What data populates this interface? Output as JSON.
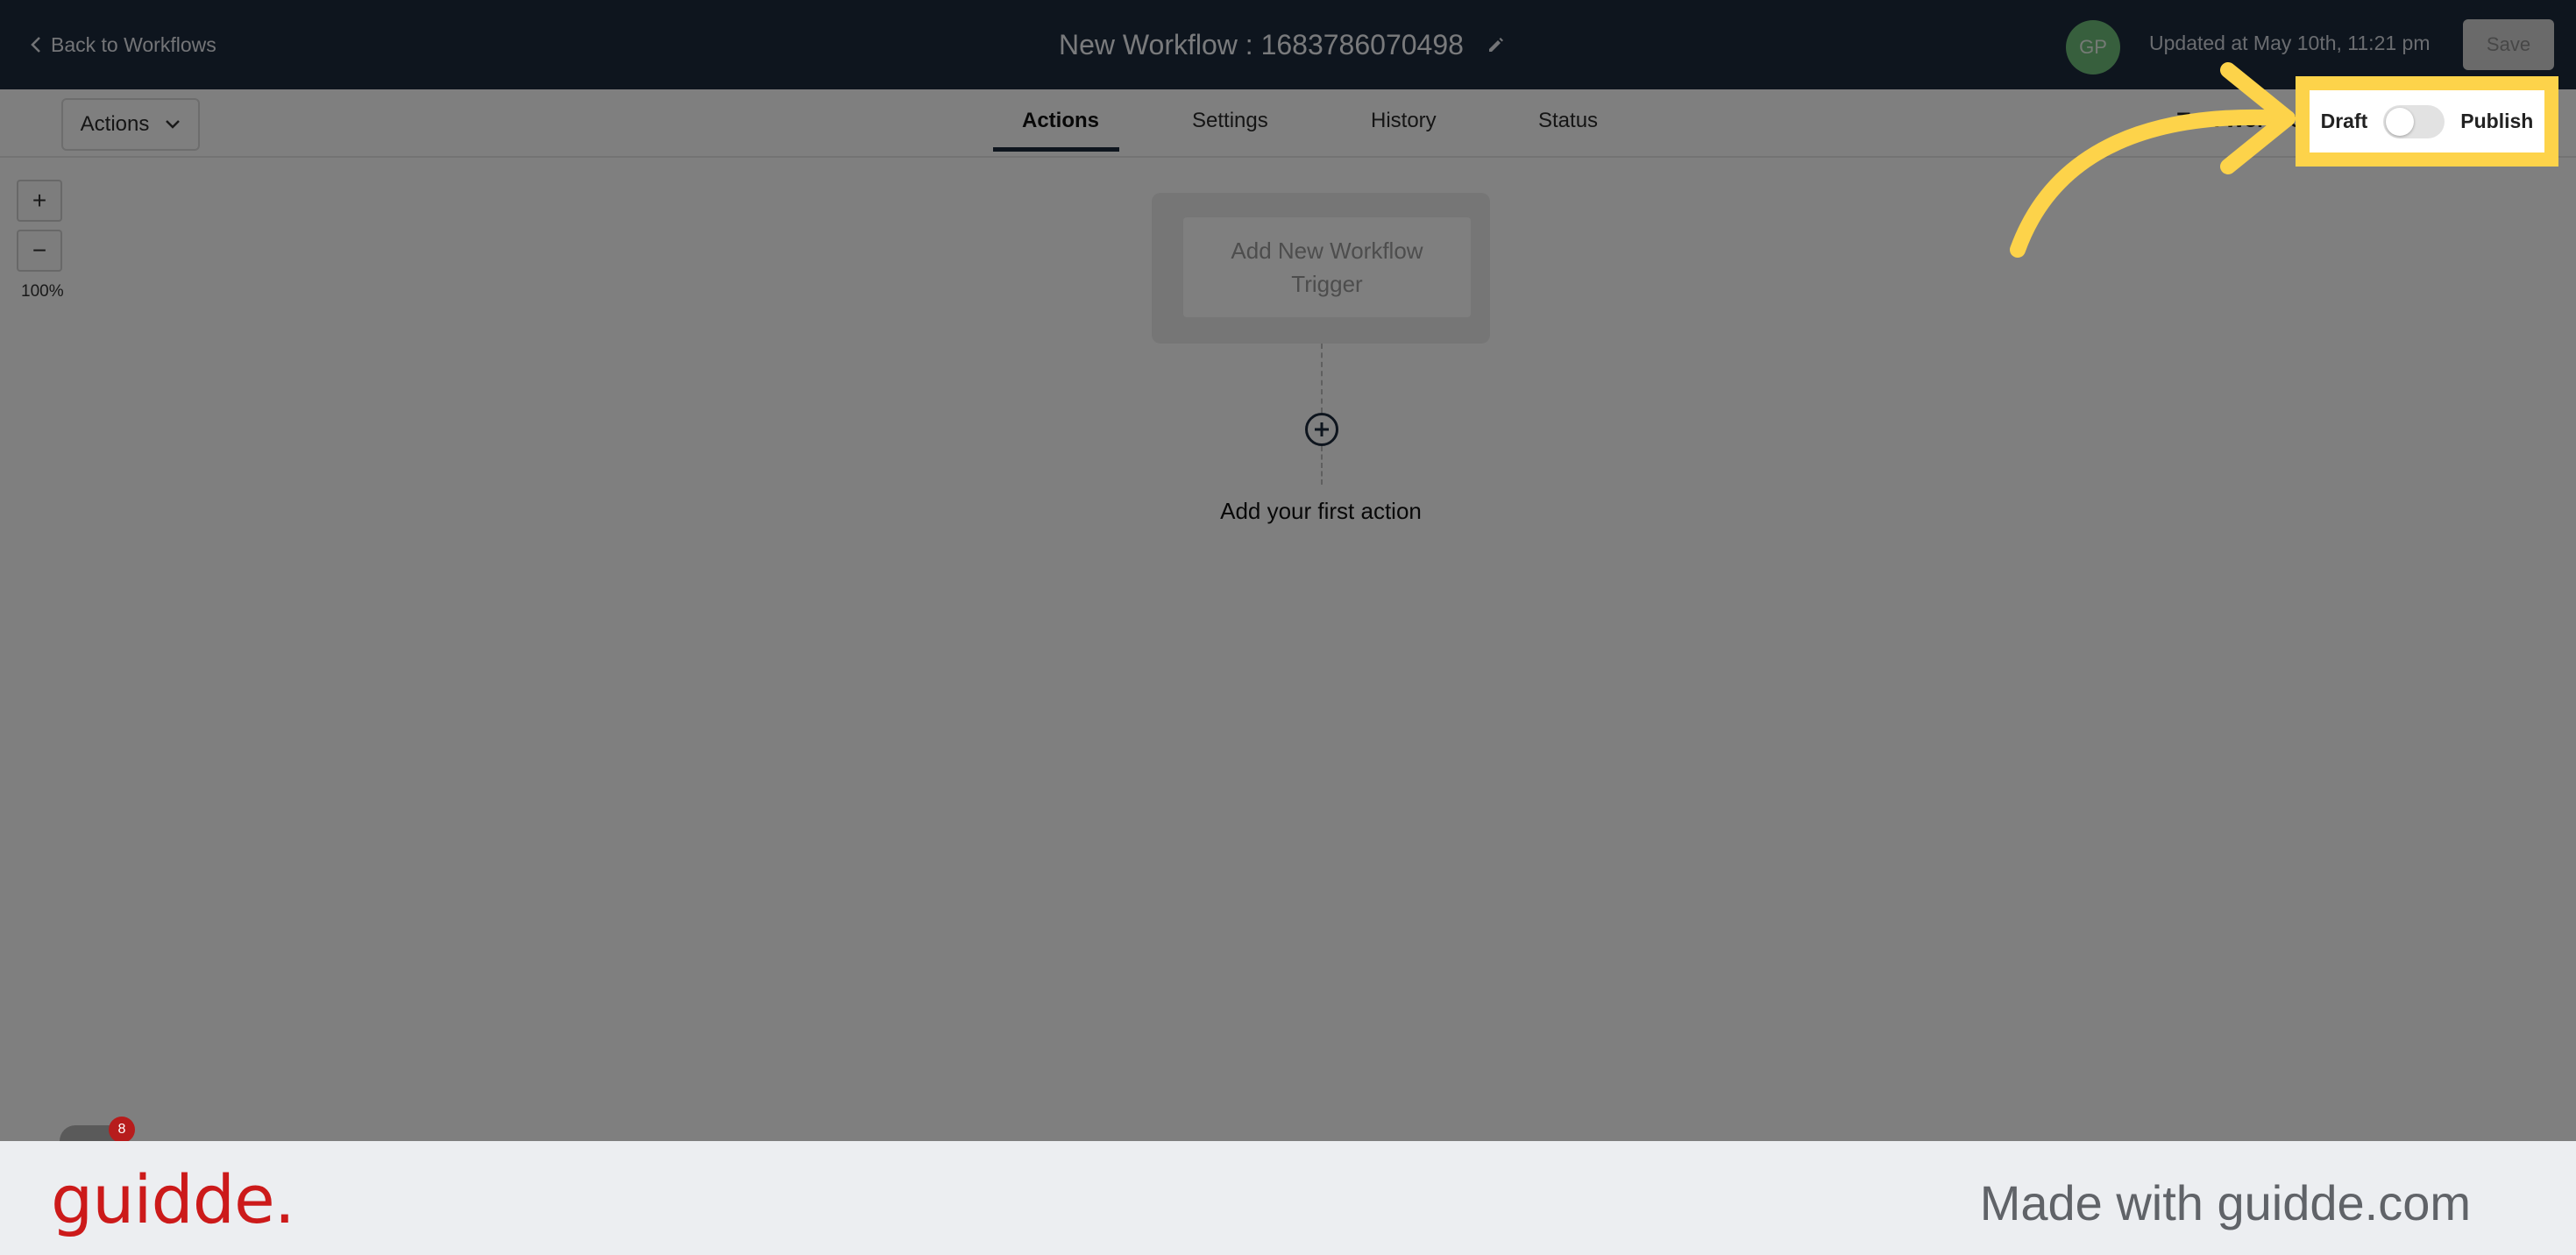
{
  "header": {
    "back_label": "Back to Workflows",
    "workflow_title": "New Workflow : 1683786070498",
    "avatar_initials": "GP",
    "updated_text": "Updated at May 10th, 11:21 pm",
    "save_label": "Save"
  },
  "toolbar": {
    "actions_dropdown_label": "Actions",
    "tabs": [
      {
        "label": "Actions",
        "active": true
      },
      {
        "label": "Settings",
        "active": false
      },
      {
        "label": "History",
        "active": false
      },
      {
        "label": "Status",
        "active": false
      }
    ],
    "partial_text": "Test Workflow"
  },
  "canvas": {
    "zoom_in_label": "+",
    "zoom_out_label": "−",
    "zoom_level": "100%",
    "trigger_label": "Add New Workflow Trigger",
    "first_action_label": "Add your first action"
  },
  "publish_toggle": {
    "draft_label": "Draft",
    "publish_label": "Publish",
    "published": false
  },
  "notifications": {
    "count": "8"
  },
  "footer": {
    "brand": "guidde.",
    "tagline": "Made with guidde.com"
  },
  "colors": {
    "header_bg": "#1d2b3d",
    "highlight": "#fdd34a",
    "brand_red": "#cc1a1a"
  }
}
